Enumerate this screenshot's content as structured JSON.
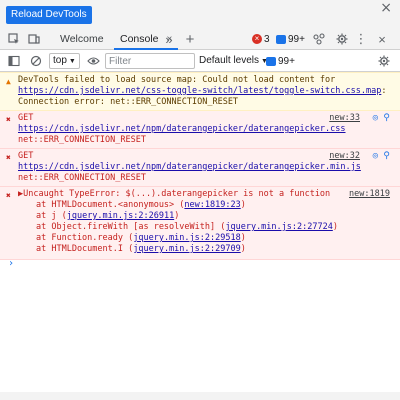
{
  "top_bar": {
    "reload_label": "Reload DevTools",
    "close_glyph": "×"
  },
  "tabs": {
    "items": [
      {
        "label": "Welcome"
      },
      {
        "label": "Console",
        "close": "×"
      }
    ],
    "more_glyph": "»",
    "add_glyph": "+",
    "error_count": "3",
    "info_count": "99+",
    "kebab_glyph": "⋮",
    "close_glyph": "×"
  },
  "toolbar": {
    "context": "top",
    "filter_placeholder": "Filter",
    "levels_label": "Default levels",
    "info_count": "99+"
  },
  "console": {
    "messages": [
      {
        "level": "warning",
        "text": "DevTools failed to load source map: Could not load content for ",
        "link": "https://cdn.jsdelivr.net/css-toggle-switch/latest/toggle-switch.css.map",
        "suffix": ": Connection error: net::ERR_CONNECTION_RESET"
      },
      {
        "level": "error",
        "prefix": "GET ",
        "link": "https://cdn.jsdelivr.net/npm/daterangepicker/daterangepicker.css",
        "suffix": " net::ERR_CONNECTION_RESET",
        "source": "new:33"
      },
      {
        "level": "error",
        "prefix": "GET ",
        "link": "https://cdn.jsdelivr.net/npm/daterangepicker/daterangepicker.min.js",
        "suffix": " net::ERR_CONNECTION_RESET",
        "source": "new:32"
      },
      {
        "level": "error",
        "text": "Uncaught TypeError: $(...).daterangepicker is not a function",
        "source": "new:1819",
        "stack": [
          {
            "text": "at HTMLDocument.<anonymous> (",
            "link": "new:1819:23",
            "end": ")"
          },
          {
            "text": "at j (",
            "link": "jquery.min.js:2:26911",
            "end": ")"
          },
          {
            "text": "at Object.fireWith [as resolveWith] (",
            "link": "jquery.min.js:2:27724",
            "end": ")"
          },
          {
            "text": "at Function.ready (",
            "link": "jquery.min.js:2:29518",
            "end": ")"
          },
          {
            "text": "at HTMLDocument.I (",
            "link": "jquery.min.js:2:29709",
            "end": ")"
          }
        ]
      }
    ],
    "prompt_glyph": "›"
  },
  "colors": {
    "accent": "#1a73e8",
    "error": "#d93025",
    "warning_bg": "#fffbe5",
    "error_bg": "#fff0f0"
  }
}
